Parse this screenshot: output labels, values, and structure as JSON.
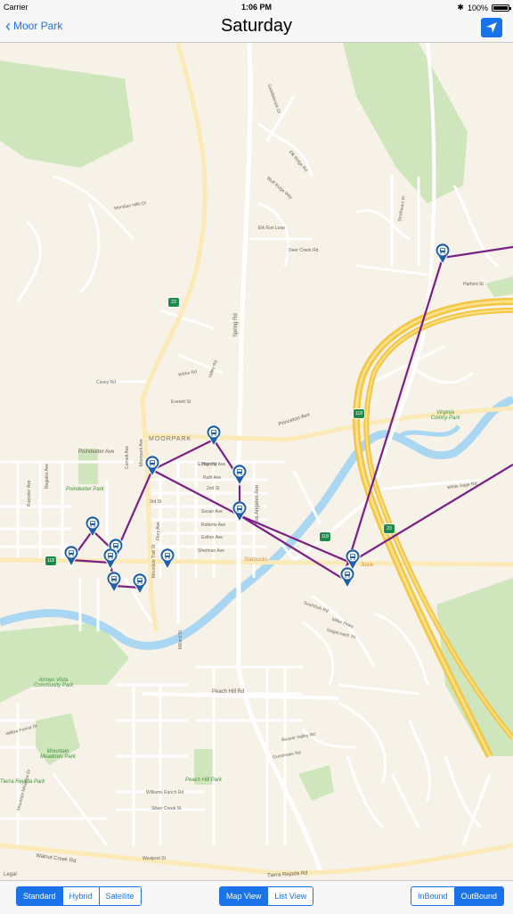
{
  "status": {
    "carrier": "Carrier",
    "time": "1:06 PM",
    "battery": "100%"
  },
  "nav": {
    "back_label": "Moor Park",
    "title": "Saturday",
    "locate_icon": "location-arrow-icon"
  },
  "map": {
    "town": "MOORPARK",
    "parks": [
      "Poindexter Park",
      "Virginia Colony Park",
      "Arroyo Vista Community Park",
      "Mountain Meadows Park",
      "Peach Hill Park",
      "Tierra Rejada Park"
    ],
    "roads": [
      "Spring Rd",
      "Princeton Ave",
      "Poindexter Ave",
      "Peach Hill Rd",
      "Walnut Creek Rd",
      "Los Angeles Ave",
      "Everett St",
      "Casey Rd",
      "Meridian Hills Dr",
      "Elk Run Loop",
      "E High St",
      "Moorpark Ave",
      "Dorothy Ave",
      "Ruth Ave",
      "Susan Ave",
      "Roberts Ave",
      "Esther Ave",
      "Sherman Ave",
      "2nd St",
      "3rd St",
      "Flory Ave",
      "Millard St",
      "Southfork Rd",
      "Miller Pkwy",
      "Stagecoach Trl",
      "White Sage Rd",
      "Willow Forest Dr",
      "Williams Ranch Rd",
      "Silver Creek St",
      "Mountain Meadow Dr",
      "Beaver Valley Rd",
      "Gunsmoke Rd",
      "Harford St",
      "Westport St",
      "Tierra Rejada Rd",
      "Wicks Rd",
      "Valley Rd",
      "Elk Ridge Rd",
      "Bluff Ridge Way",
      "Saddlebrook Dr",
      "Deer Creek Rd",
      "Cornett Ave",
      "Nogales Ave",
      "Ruessler Ave",
      "Mountain Trail St",
      "Strathearn Pl"
    ],
    "poi": [
      "Starbucks",
      "Juice"
    ],
    "highways": [
      "23",
      "118",
      "118",
      "118",
      "23"
    ],
    "legal": "Legal",
    "route_color": "#7b1f87",
    "stop_icon": "bus-stop-pin-icon"
  },
  "bottom": {
    "map_type": {
      "options": [
        "Standard",
        "Hybrid",
        "Satellite"
      ],
      "selected": "Standard"
    },
    "view": {
      "options": [
        "Map View",
        "List View"
      ],
      "selected": "Map View"
    },
    "direction": {
      "options": [
        "InBound",
        "OutBound"
      ],
      "selected": "OutBound"
    }
  }
}
